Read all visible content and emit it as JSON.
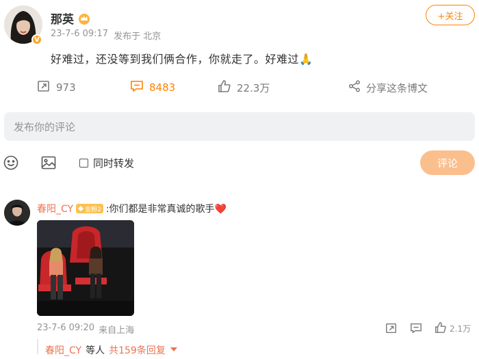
{
  "post": {
    "username": "那英",
    "time": "23-7-6 09:17",
    "source": "发布于 北京",
    "follow_label": "+关注",
    "text": "好难过，还没等到我们俩合作，你就走了。好难过🙏",
    "reposts": "973",
    "comments": "8483",
    "likes": "22.3万",
    "share_label": "分享这条博文"
  },
  "composer": {
    "placeholder": "发布你的评论",
    "sync_label": "同时转发",
    "submit_label": "评论"
  },
  "comment": {
    "username": "春阳_CY",
    "level_badge": "金粉2",
    "text": ":你们都是非常真诚的歌手❤️",
    "time": "23-7-6 09:20",
    "location": "来自上海",
    "likes": "2.1万",
    "replies_user": "春阳_CY",
    "replies_mid": "等人",
    "replies_count": "共159条回复"
  },
  "colors": {
    "accent": "#ff8200",
    "username_link": "#eb7350",
    "submit_bg": "#fbbf8e"
  },
  "icons": [
    "vip-badge-icon",
    "crown-icon",
    "repost-icon",
    "comment-icon",
    "like-icon",
    "share-icon",
    "emoji-icon",
    "image-icon",
    "checkbox",
    "chevron-down-icon"
  ]
}
